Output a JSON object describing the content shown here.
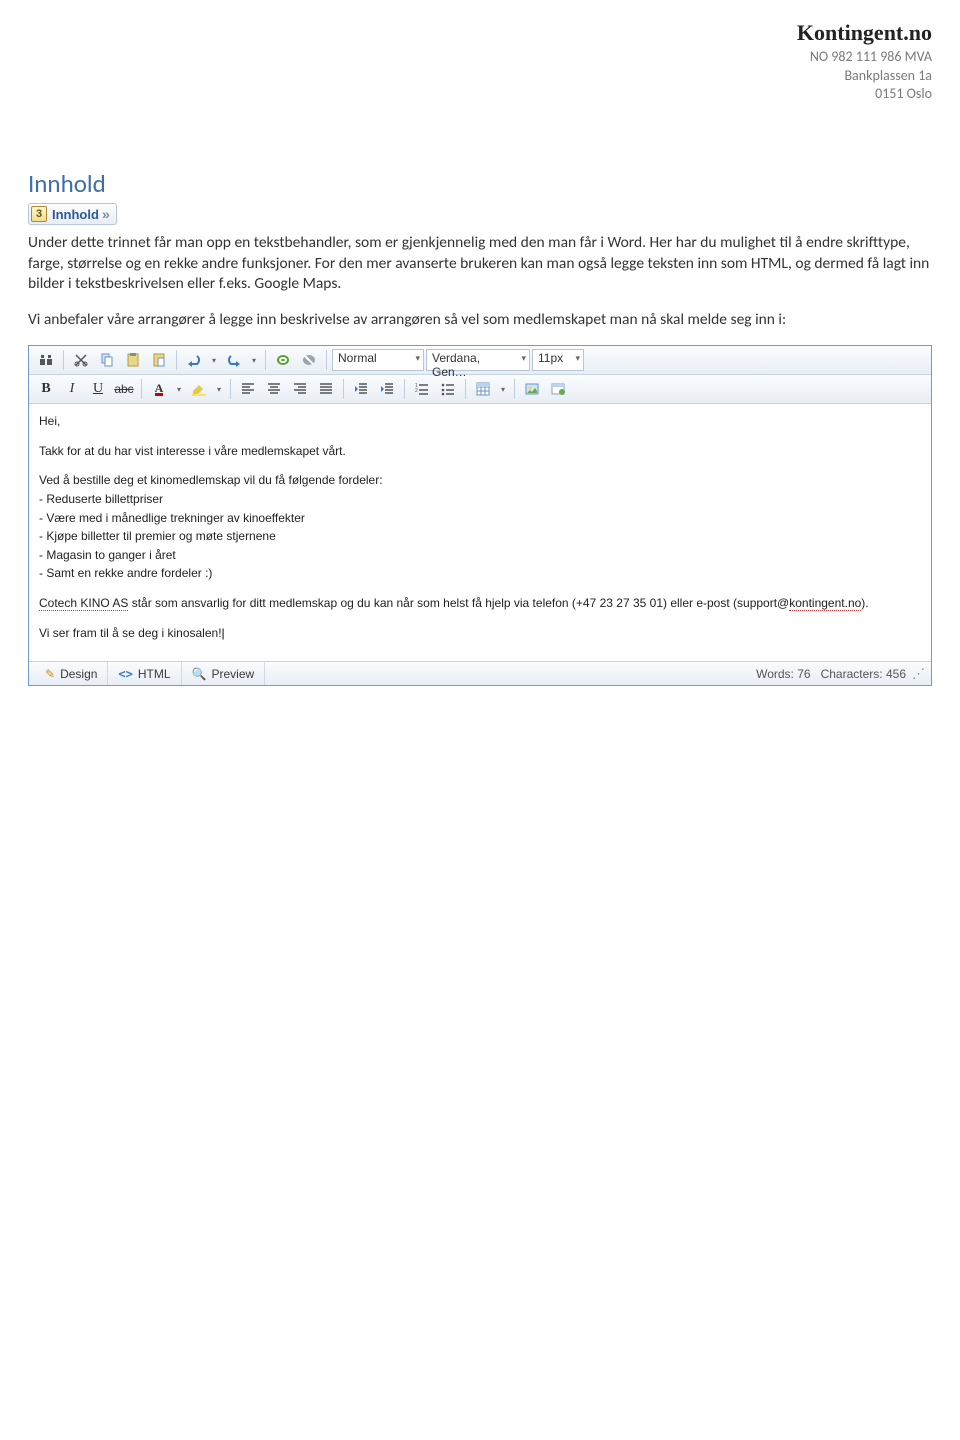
{
  "header": {
    "brand": "Kontingent.no",
    "vat": "NO 982 111 986 MVA",
    "addr1": "Bankplassen 1a",
    "addr2": "0151 Oslo"
  },
  "section": {
    "title": "Innhold",
    "breadcrumb_num": "3",
    "breadcrumb_label": "Innhold"
  },
  "body": {
    "text": "Under dette trinnet får man opp en tekstbehandler, som er gjenkjennelig med den man får i Word. Her har du mulighet til å endre skrifttype, farge, størrelse og en rekke andre funksjoner. For den mer avanserte brukeren kan man også legge teksten inn som HTML, og dermed få lagt inn bilder i tekstbeskrivelsen eller f.eks. Google Maps.",
    "text2": "Vi anbefaler våre arrangører å legge inn beskrivelse av arrangøren så vel som medlemskapet man nå skal melde seg inn i:"
  },
  "editor": {
    "toolbar": {
      "style": "Normal",
      "font": "Verdana, Gen…",
      "size": "11px"
    },
    "content": {
      "p1": "Hei,",
      "p2": "Takk for at du har vist interesse i våre medlemskapet vårt.",
      "p3_intro": "Ved å bestille deg et kinomedlemskap vil du få følgende fordeler:",
      "p3_b1": "- Reduserte billettpriser",
      "p3_b2": "- Være med i månedlige trekninger av kinoeffekter",
      "p3_b3": "- Kjøpe billetter til premier og møte stjernene",
      "p3_b4": "- Magasin to ganger i året",
      "p3_b5": "- Samt en rekke andre fordeler :)",
      "p4a": "Cotech KINO AS",
      "p4b": " står som ansvarlig for ditt medlemskap og du kan når som helst få hjelp via telefon (+47 23 27 35 01) eller e-post (support@",
      "p4c": "kontingent.no",
      "p4d": ").",
      "p5": "Vi ser fram til å se deg i kinosalen!"
    },
    "footer": {
      "tab_design": "Design",
      "tab_html": "HTML",
      "tab_preview": "Preview",
      "words_label": "Words:",
      "words": "76",
      "chars_label": "Characters:",
      "chars": "456"
    }
  }
}
